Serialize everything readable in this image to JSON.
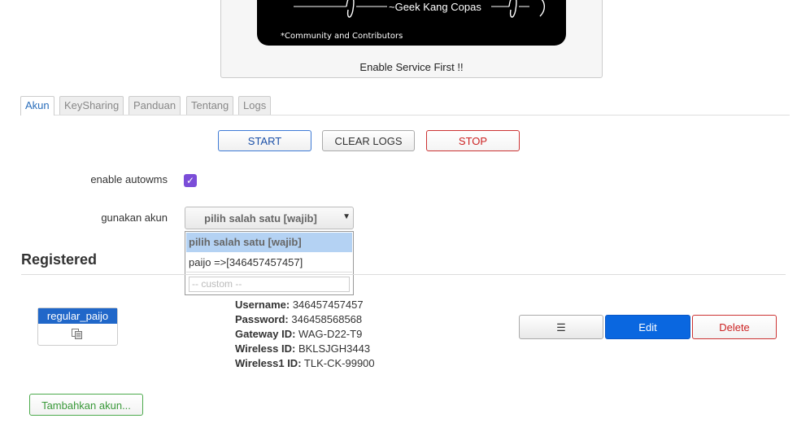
{
  "banner": {
    "tagline": "~Geek Kang Copas",
    "community": "*Community and Contributors",
    "status": "Enable Service First !!"
  },
  "tabs": [
    {
      "label": "Akun",
      "active": true
    },
    {
      "label": "KeySharing",
      "active": false
    },
    {
      "label": "Panduan",
      "active": false
    },
    {
      "label": "Tentang",
      "active": false
    },
    {
      "label": "Logs",
      "active": false
    }
  ],
  "controls": {
    "start_label": "START",
    "clear_logs_label": "CLEAR LOGS",
    "stop_label": "STOP"
  },
  "form": {
    "autowms_label": "enable autowms",
    "autowms_checked": true,
    "akun_label": "gunakan akun",
    "akun_selected": "pilih salah satu [wajib]",
    "akun_options": [
      "pilih salah satu [wajib]",
      "paijo =>[346457457457]"
    ],
    "custom_placeholder": "-- custom --"
  },
  "registered": {
    "heading": "Registered",
    "card_title": "regular_paijo",
    "username_label": "Username:",
    "username": "346457457457",
    "password_label": "Password:",
    "password": "346458568568",
    "gateway_label": "Gateway ID:",
    "gateway": "WAG-D22-T9",
    "wireless_label": "Wireless ID:",
    "wireless": "BKLSJGH3443",
    "wireless1_label": "Wireless1 ID:",
    "wireless1": "TLK-CK-99900",
    "menu_label": "☰",
    "edit_label": "Edit",
    "delete_label": "Delete",
    "add_label": "Tambahkan akun..."
  },
  "colors": {
    "accent": "#0a67e0",
    "checkbox": "#7b4dd8",
    "danger": "#cc2222",
    "success": "#3a993a"
  }
}
